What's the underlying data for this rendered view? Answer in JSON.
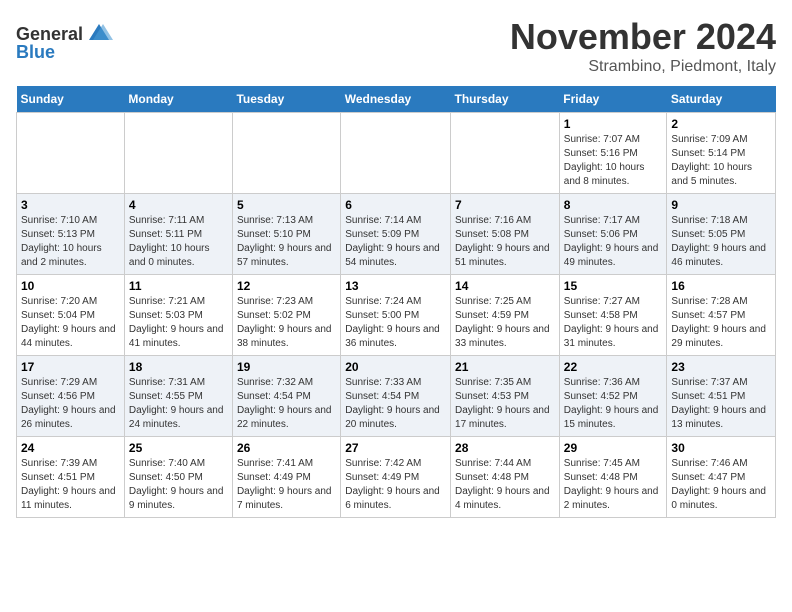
{
  "header": {
    "logo_general": "General",
    "logo_blue": "Blue",
    "month_title": "November 2024",
    "location": "Strambino, Piedmont, Italy"
  },
  "days_of_week": [
    "Sunday",
    "Monday",
    "Tuesday",
    "Wednesday",
    "Thursday",
    "Friday",
    "Saturday"
  ],
  "weeks": [
    [
      {
        "day": "",
        "info": ""
      },
      {
        "day": "",
        "info": ""
      },
      {
        "day": "",
        "info": ""
      },
      {
        "day": "",
        "info": ""
      },
      {
        "day": "",
        "info": ""
      },
      {
        "day": "1",
        "info": "Sunrise: 7:07 AM\nSunset: 5:16 PM\nDaylight: 10 hours and 8 minutes."
      },
      {
        "day": "2",
        "info": "Sunrise: 7:09 AM\nSunset: 5:14 PM\nDaylight: 10 hours and 5 minutes."
      }
    ],
    [
      {
        "day": "3",
        "info": "Sunrise: 7:10 AM\nSunset: 5:13 PM\nDaylight: 10 hours and 2 minutes."
      },
      {
        "day": "4",
        "info": "Sunrise: 7:11 AM\nSunset: 5:11 PM\nDaylight: 10 hours and 0 minutes."
      },
      {
        "day": "5",
        "info": "Sunrise: 7:13 AM\nSunset: 5:10 PM\nDaylight: 9 hours and 57 minutes."
      },
      {
        "day": "6",
        "info": "Sunrise: 7:14 AM\nSunset: 5:09 PM\nDaylight: 9 hours and 54 minutes."
      },
      {
        "day": "7",
        "info": "Sunrise: 7:16 AM\nSunset: 5:08 PM\nDaylight: 9 hours and 51 minutes."
      },
      {
        "day": "8",
        "info": "Sunrise: 7:17 AM\nSunset: 5:06 PM\nDaylight: 9 hours and 49 minutes."
      },
      {
        "day": "9",
        "info": "Sunrise: 7:18 AM\nSunset: 5:05 PM\nDaylight: 9 hours and 46 minutes."
      }
    ],
    [
      {
        "day": "10",
        "info": "Sunrise: 7:20 AM\nSunset: 5:04 PM\nDaylight: 9 hours and 44 minutes."
      },
      {
        "day": "11",
        "info": "Sunrise: 7:21 AM\nSunset: 5:03 PM\nDaylight: 9 hours and 41 minutes."
      },
      {
        "day": "12",
        "info": "Sunrise: 7:23 AM\nSunset: 5:02 PM\nDaylight: 9 hours and 38 minutes."
      },
      {
        "day": "13",
        "info": "Sunrise: 7:24 AM\nSunset: 5:00 PM\nDaylight: 9 hours and 36 minutes."
      },
      {
        "day": "14",
        "info": "Sunrise: 7:25 AM\nSunset: 4:59 PM\nDaylight: 9 hours and 33 minutes."
      },
      {
        "day": "15",
        "info": "Sunrise: 7:27 AM\nSunset: 4:58 PM\nDaylight: 9 hours and 31 minutes."
      },
      {
        "day": "16",
        "info": "Sunrise: 7:28 AM\nSunset: 4:57 PM\nDaylight: 9 hours and 29 minutes."
      }
    ],
    [
      {
        "day": "17",
        "info": "Sunrise: 7:29 AM\nSunset: 4:56 PM\nDaylight: 9 hours and 26 minutes."
      },
      {
        "day": "18",
        "info": "Sunrise: 7:31 AM\nSunset: 4:55 PM\nDaylight: 9 hours and 24 minutes."
      },
      {
        "day": "19",
        "info": "Sunrise: 7:32 AM\nSunset: 4:54 PM\nDaylight: 9 hours and 22 minutes."
      },
      {
        "day": "20",
        "info": "Sunrise: 7:33 AM\nSunset: 4:54 PM\nDaylight: 9 hours and 20 minutes."
      },
      {
        "day": "21",
        "info": "Sunrise: 7:35 AM\nSunset: 4:53 PM\nDaylight: 9 hours and 17 minutes."
      },
      {
        "day": "22",
        "info": "Sunrise: 7:36 AM\nSunset: 4:52 PM\nDaylight: 9 hours and 15 minutes."
      },
      {
        "day": "23",
        "info": "Sunrise: 7:37 AM\nSunset: 4:51 PM\nDaylight: 9 hours and 13 minutes."
      }
    ],
    [
      {
        "day": "24",
        "info": "Sunrise: 7:39 AM\nSunset: 4:51 PM\nDaylight: 9 hours and 11 minutes."
      },
      {
        "day": "25",
        "info": "Sunrise: 7:40 AM\nSunset: 4:50 PM\nDaylight: 9 hours and 9 minutes."
      },
      {
        "day": "26",
        "info": "Sunrise: 7:41 AM\nSunset: 4:49 PM\nDaylight: 9 hours and 7 minutes."
      },
      {
        "day": "27",
        "info": "Sunrise: 7:42 AM\nSunset: 4:49 PM\nDaylight: 9 hours and 6 minutes."
      },
      {
        "day": "28",
        "info": "Sunrise: 7:44 AM\nSunset: 4:48 PM\nDaylight: 9 hours and 4 minutes."
      },
      {
        "day": "29",
        "info": "Sunrise: 7:45 AM\nSunset: 4:48 PM\nDaylight: 9 hours and 2 minutes."
      },
      {
        "day": "30",
        "info": "Sunrise: 7:46 AM\nSunset: 4:47 PM\nDaylight: 9 hours and 0 minutes."
      }
    ]
  ]
}
